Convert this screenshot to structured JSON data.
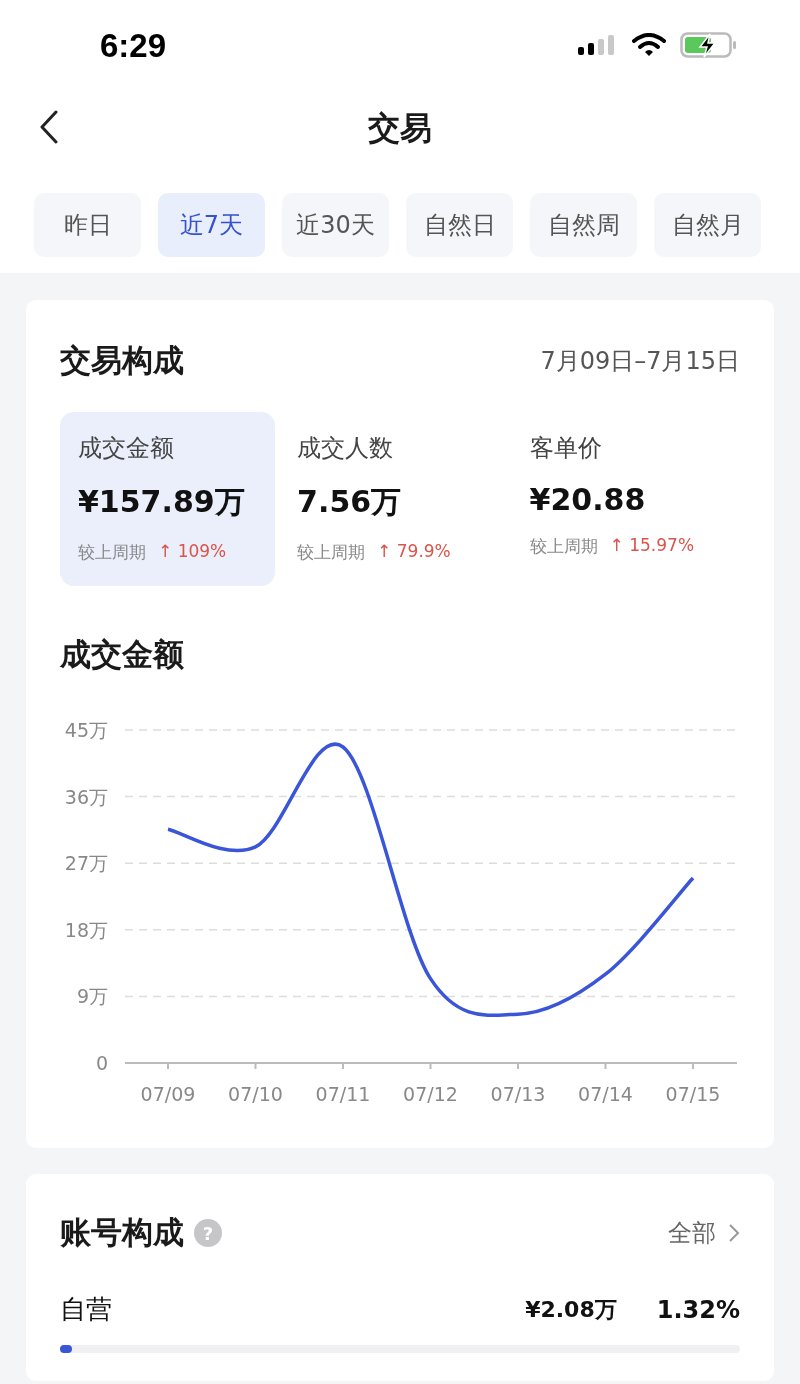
{
  "status_bar": {
    "time": "6:29"
  },
  "nav": {
    "title": "交易"
  },
  "tabs": [
    {
      "label": "昨日",
      "selected": false
    },
    {
      "label": "近7天",
      "selected": true
    },
    {
      "label": "近30天",
      "selected": false
    },
    {
      "label": "自然日",
      "selected": false
    },
    {
      "label": "自然周",
      "selected": false
    },
    {
      "label": "自然月",
      "selected": false
    }
  ],
  "composition": {
    "title": "交易构成",
    "date_range": "7月09日–7月15日",
    "metrics": [
      {
        "label": "成交金额",
        "value": "¥157.89万",
        "compare_label": "较上周期",
        "change": "↑ 109%",
        "selected": true
      },
      {
        "label": "成交人数",
        "value": "7.56万",
        "compare_label": "较上周期",
        "change": "↑ 79.9%",
        "selected": false
      },
      {
        "label": "客单价",
        "value": "¥20.88",
        "compare_label": "较上周期",
        "change": "↑ 15.97%",
        "selected": false
      }
    ],
    "chart_title": "成交金额",
    "chart_data": {
      "type": "line",
      "categories": [
        "07/09",
        "07/10",
        "07/11",
        "07/12",
        "07/13",
        "07/14",
        "07/15"
      ],
      "grid": true,
      "series": [
        {
          "color": "#3b55d9",
          "values": [
            31.6,
            29.2,
            42.7,
            11.4,
            6.6,
            12.0,
            25.0
          ]
        }
      ],
      "ylim": [
        0,
        45
      ],
      "yticks": [
        {
          "value": 0,
          "label": "0"
        },
        {
          "value": 9,
          "label": "9万"
        },
        {
          "value": 18,
          "label": "18万"
        },
        {
          "value": 27,
          "label": "27万"
        },
        {
          "value": 36,
          "label": "36万"
        },
        {
          "value": 45,
          "label": "45万"
        }
      ]
    }
  },
  "accounts": {
    "title": "账号构成",
    "help_icon": "?",
    "link": "全部",
    "rows": [
      {
        "name": "自营",
        "amount": "¥2.08万",
        "share": "1.32%",
        "level": 0.0132
      }
    ]
  }
}
